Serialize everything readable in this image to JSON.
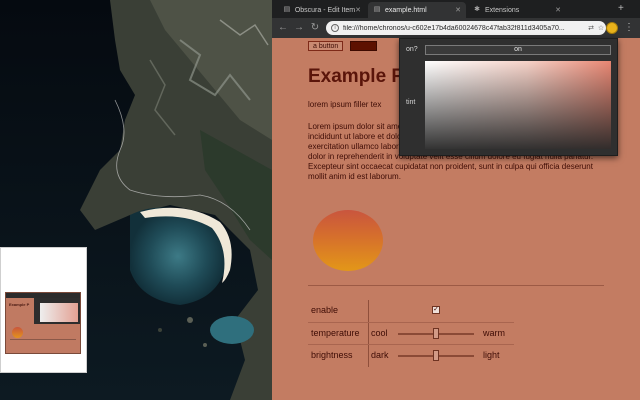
{
  "tabs": [
    {
      "label": "Obscura - Edit Item",
      "icon": "page-icon",
      "active": false
    },
    {
      "label": "example.html",
      "icon": "page-icon",
      "active": true
    },
    {
      "label": "Extensions",
      "icon": "puzzle-icon",
      "active": false
    }
  ],
  "toolbar": {
    "url": "file:///home/chronos/u-c602e17b4da60024678c47fab32f811d3405a70..."
  },
  "page": {
    "button_label": "a button",
    "swatch_color": "#5d1100",
    "title": "Example P",
    "filler": "lorem ipsum filler tex",
    "lorem": "Lorem ipsum dolor sit amet, consectetur adipiscing elit, sed do eiusmod tempor incididunt ut labore et dolore magna aliqua. Ut enim ad minim veniam, quis nostrud exercitation ullamco laboris nisi ut aliquip ex ea commodo consequat. Duis aute irure dolor in reprehenderit in voluptate velit esse cillum dolore eu fugiat nulla pariatur. Excepteur sint occaecat cupidatat non proident, sunt in culpa qui officia deserunt mollit anim id est laborum.",
    "controls": [
      {
        "label": "enable",
        "type": "checkbox",
        "checked": true
      },
      {
        "label": "temperature",
        "left": "cool",
        "right": "warm",
        "value": 0.5
      },
      {
        "label": "brightness",
        "left": "dark",
        "right": "light",
        "value": 0.5
      }
    ]
  },
  "popup": {
    "on_label": "on?",
    "on_value": "on",
    "tint_label": "tint"
  },
  "colors": {
    "page_bg": "#c37c62",
    "text": "#3e0c05",
    "popup_bg": "#2f2f2f",
    "extension_icon": "#e9b21b"
  }
}
